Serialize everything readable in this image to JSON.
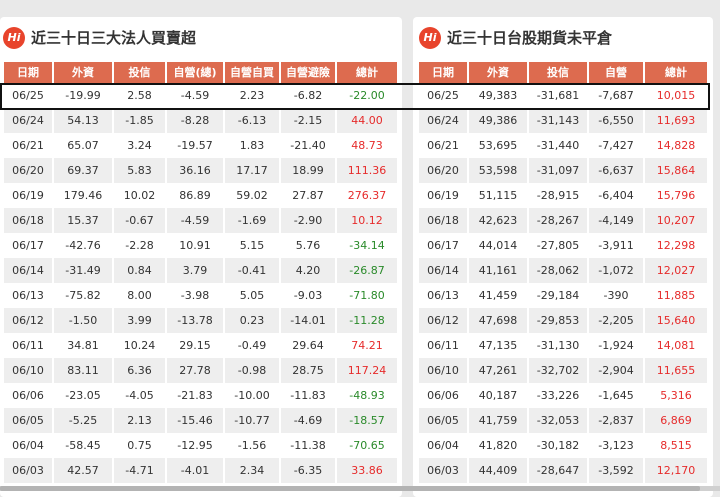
{
  "left_panel": {
    "logo": "Hi",
    "title": "近三十日三大法人買賣超",
    "headers": [
      "日期",
      "外資",
      "投信",
      "自營(總)",
      "自營自買",
      "自營避險",
      "總計"
    ],
    "rows": [
      [
        "06/25",
        "-19.99",
        "2.58",
        "-4.59",
        "2.23",
        "-6.82",
        "-22.00"
      ],
      [
        "06/24",
        "54.13",
        "-1.85",
        "-8.28",
        "-6.13",
        "-2.15",
        "44.00"
      ],
      [
        "06/21",
        "65.07",
        "3.24",
        "-19.57",
        "1.83",
        "-21.40",
        "48.73"
      ],
      [
        "06/20",
        "69.37",
        "5.83",
        "36.16",
        "17.17",
        "18.99",
        "111.36"
      ],
      [
        "06/19",
        "179.46",
        "10.02",
        "86.89",
        "59.02",
        "27.87",
        "276.37"
      ],
      [
        "06/18",
        "15.37",
        "-0.67",
        "-4.59",
        "-1.69",
        "-2.90",
        "10.12"
      ],
      [
        "06/17",
        "-42.76",
        "-2.28",
        "10.91",
        "5.15",
        "5.76",
        "-34.14"
      ],
      [
        "06/14",
        "-31.49",
        "0.84",
        "3.79",
        "-0.41",
        "4.20",
        "-26.87"
      ],
      [
        "06/13",
        "-75.82",
        "8.00",
        "-3.98",
        "5.05",
        "-9.03",
        "-71.80"
      ],
      [
        "06/12",
        "-1.50",
        "3.99",
        "-13.78",
        "0.23",
        "-14.01",
        "-11.28"
      ],
      [
        "06/11",
        "34.81",
        "10.24",
        "29.15",
        "-0.49",
        "29.64",
        "74.21"
      ],
      [
        "06/10",
        "83.11",
        "6.36",
        "27.78",
        "-0.98",
        "28.75",
        "117.24"
      ],
      [
        "06/06",
        "-23.05",
        "-4.05",
        "-21.83",
        "-10.00",
        "-11.83",
        "-48.93"
      ],
      [
        "06/05",
        "-5.25",
        "2.13",
        "-15.46",
        "-10.77",
        "-4.69",
        "-18.57"
      ],
      [
        "06/04",
        "-58.45",
        "0.75",
        "-12.95",
        "-1.56",
        "-11.38",
        "-70.65"
      ],
      [
        "06/03",
        "42.57",
        "-4.71",
        "-4.01",
        "2.34",
        "-6.35",
        "33.86"
      ]
    ]
  },
  "right_panel": {
    "logo": "Hi",
    "title": "近三十日台股期貨未平倉",
    "headers": [
      "日期",
      "外資",
      "投信",
      "自營",
      "總計"
    ],
    "rows": [
      [
        "06/25",
        "49,383",
        "-31,681",
        "-7,687",
        "10,015"
      ],
      [
        "06/24",
        "49,386",
        "-31,143",
        "-6,550",
        "11,693"
      ],
      [
        "06/21",
        "53,695",
        "-31,440",
        "-7,427",
        "14,828"
      ],
      [
        "06/20",
        "53,598",
        "-31,097",
        "-6,637",
        "15,864"
      ],
      [
        "06/19",
        "51,115",
        "-28,915",
        "-6,404",
        "15,796"
      ],
      [
        "06/18",
        "42,623",
        "-28,267",
        "-4,149",
        "10,207"
      ],
      [
        "06/17",
        "44,014",
        "-27,805",
        "-3,911",
        "12,298"
      ],
      [
        "06/14",
        "41,161",
        "-28,062",
        "-1,072",
        "12,027"
      ],
      [
        "06/13",
        "41,459",
        "-29,184",
        "-390",
        "11,885"
      ],
      [
        "06/12",
        "47,698",
        "-29,853",
        "-2,205",
        "15,640"
      ],
      [
        "06/11",
        "47,135",
        "-31,130",
        "-1,924",
        "14,081"
      ],
      [
        "06/10",
        "47,261",
        "-32,702",
        "-2,904",
        "11,655"
      ],
      [
        "06/06",
        "40,187",
        "-33,226",
        "-1,645",
        "5,316"
      ],
      [
        "06/05",
        "41,759",
        "-32,053",
        "-2,837",
        "6,869"
      ],
      [
        "06/04",
        "41,820",
        "-30,182",
        "-3,123",
        "8,515"
      ],
      [
        "06/03",
        "44,409",
        "-28,647",
        "-3,592",
        "12,170"
      ]
    ]
  },
  "colors": {
    "header_bg": "#dd6b4f",
    "positive_total": "#e62b2b",
    "negative_total": "#2a8a2a",
    "logo_bg": "#e8442c"
  }
}
